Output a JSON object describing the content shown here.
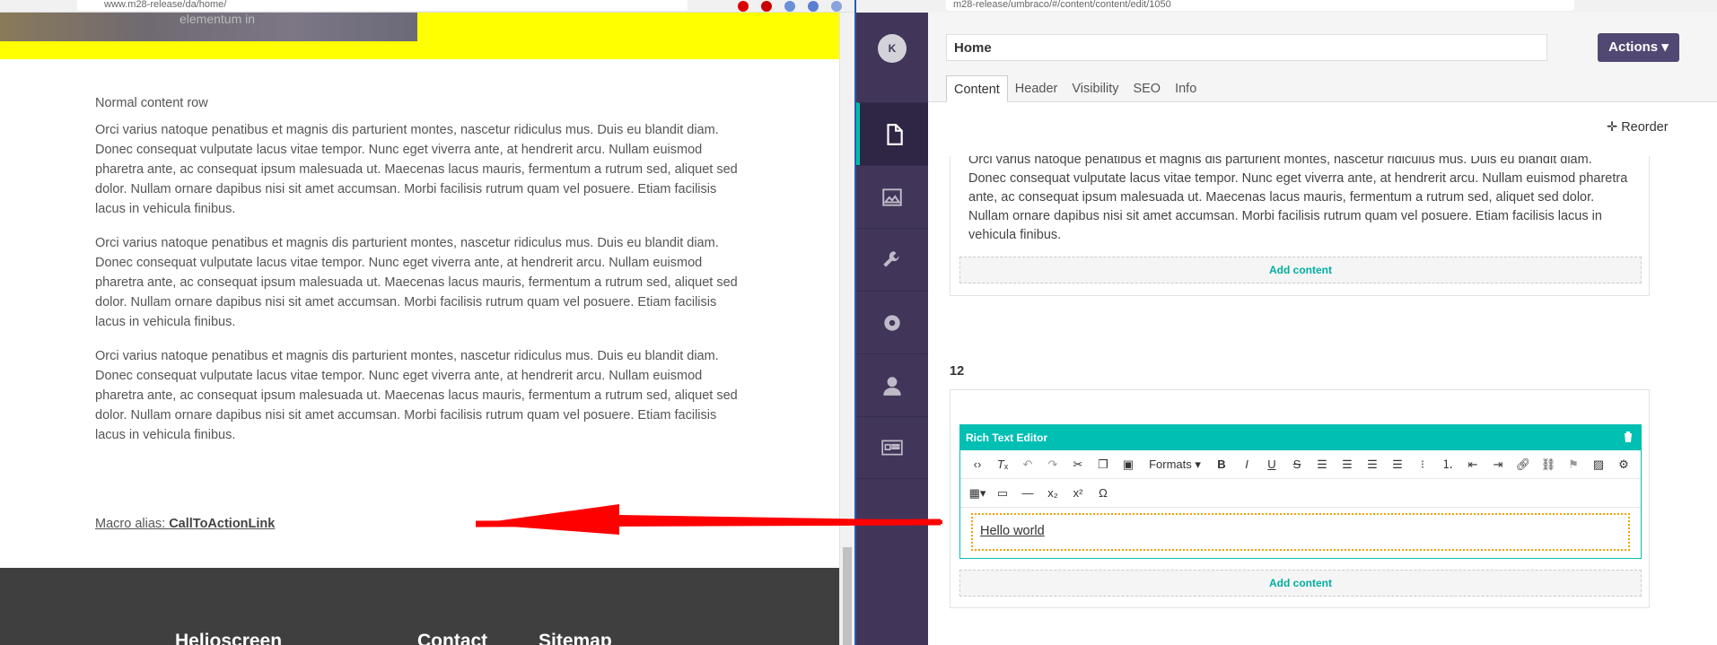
{
  "left_browser": {
    "url": "www.m28-release/da/home/",
    "hero_text": "elementum in",
    "content": {
      "heading": "Normal content row",
      "paragraphs": [
        "Orci varius natoque penatibus et magnis dis parturient montes, nascetur ridiculus mus. Duis eu blandit diam. Donec consequat vulputate lacus vitae tempor. Nunc eget viverra ante, at hendrerit arcu. Nullam euismod pharetra ante, ac consequat ipsum malesuada ut. Maecenas lacus mauris, fermentum a rutrum sed, aliquet sed dolor. Nullam ornare dapibus nisi sit amet accumsan. Morbi facilisis rutrum quam vel posuere. Etiam facilisis lacus in vehicula finibus.",
        "Orci varius natoque penatibus et magnis dis parturient montes, nascetur ridiculus mus. Duis eu blandit diam. Donec consequat vulputate lacus vitae tempor. Nunc eget viverra ante, at hendrerit arcu. Nullam euismod pharetra ante, ac consequat ipsum malesuada ut. Maecenas lacus mauris, fermentum a rutrum sed, aliquet sed dolor. Nullam ornare dapibus nisi sit amet accumsan. Morbi facilisis rutrum quam vel posuere. Etiam facilisis lacus in vehicula finibus.",
        "Orci varius natoque penatibus et magnis dis parturient montes, nascetur ridiculus mus. Duis eu blandit diam. Donec consequat vulputate lacus vitae tempor. Nunc eget viverra ante, at hendrerit arcu. Nullam euismod pharetra ante, ac consequat ipsum malesuada ut. Maecenas lacus mauris, fermentum a rutrum sed, aliquet sed dolor. Nullam ornare dapibus nisi sit amet accumsan. Morbi facilisis rutrum quam vel posuere. Etiam facilisis lacus in vehicula finibus."
      ]
    },
    "macro": {
      "prefix": "Macro alias: ",
      "alias": "CallToActionLink"
    },
    "footer": {
      "col1": "Helioscreen",
      "col2": "Contact",
      "col3": "Sitemap"
    }
  },
  "right_browser": {
    "url": "m28-release/umbraco/#/content/content/edit/1050",
    "avatar_initial": "K",
    "nav": [
      "content-icon",
      "media-icon",
      "wrench-icon",
      "gear-icon",
      "user-icon",
      "id-card-icon"
    ],
    "node_name": "Home",
    "actions_label": "Actions ▾",
    "tabs": [
      "Content",
      "Header",
      "Visibility",
      "SEO",
      "Info"
    ],
    "reorder_label": "Reorder",
    "card1_text": "Orci varius natoque penatibus et magnis dis parturient montes, nascetur ridiculus mus. Duis eu blandit diam. Donec consequat vulputate lacus vitae tempor. Nunc eget viverra ante, at hendrerit arcu. Nullam euismod pharetra ante, ac consequat ipsum malesuada ut. Maecenas lacus mauris, fermentum a rutrum sed, aliquet sed dolor. Nullam ornare dapibus nisi sit amet accumsan. Morbi facilisis rutrum quam vel posuere. Etiam facilisis lacus in vehicula finibus.",
    "add_content_label": "Add content",
    "row_label": "12",
    "rte": {
      "title": "Rich Text Editor",
      "formats_label": "Formats ▾",
      "content": "Hello world"
    }
  },
  "colors": {
    "yellow": "#ffff00",
    "sidebar": "#413659",
    "teal": "#00bfb3",
    "actions": "#514873",
    "arrow": "#ff0000"
  }
}
